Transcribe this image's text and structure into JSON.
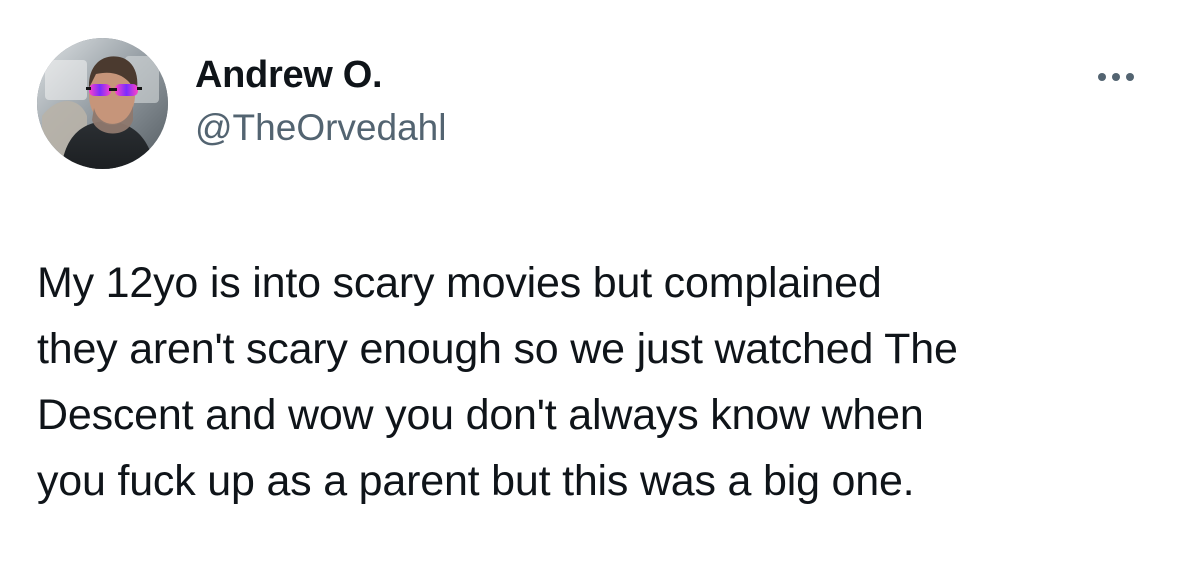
{
  "tweet": {
    "author": {
      "display_name": "Andrew O.",
      "handle": "@TheOrvedahl",
      "avatar_icon": "profile-photo"
    },
    "more_icon": "more-horizontal-icon",
    "text_lines": [
      "My 12yo is into scary movies but complained",
      "they aren't scary enough so we just watched The",
      "Descent and wow you don't always know when",
      "you fuck up as a parent but this was a big one."
    ]
  },
  "colors": {
    "text_primary": "#0f1419",
    "text_secondary": "#536471",
    "background": "#ffffff"
  }
}
